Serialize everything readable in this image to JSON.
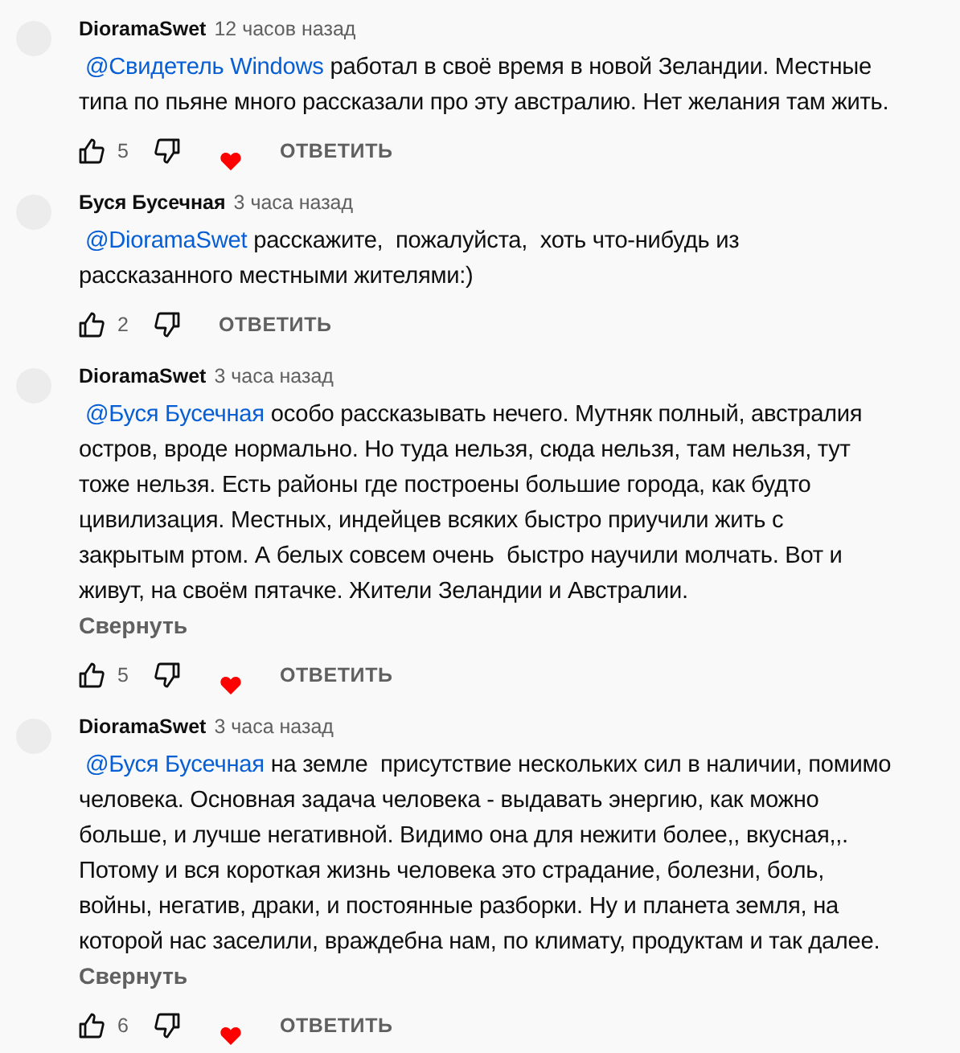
{
  "comments": [
    {
      "author": "DioramaSwet",
      "time": "12 часов назад",
      "mention": "@Свидетель Windows",
      "text": "работал в своё время в новой Зеландии. Местные\nтипа по пьяне много рассказали про эту австралию. Нет желания там жить.",
      "likes": "5",
      "hearted": true,
      "reply": "ОТВЕТИТЬ"
    },
    {
      "author": "Буся Бусечная",
      "time": "3 часа назад",
      "mention": "@DioramaSwet",
      "text": "расскажите,  пожалуйста,  хоть что-нибудь из\nрассказанного местными жителями:)",
      "likes": "2",
      "hearted": false,
      "reply": "ОТВЕТИТЬ"
    },
    {
      "author": "DioramaSwet",
      "time": "3 часа назад",
      "mention": "@Буся Бусечная",
      "text": "особо рассказывать нечего. Мутняк полный, австралия\nостров, вроде нормально. Но туда нельзя, сюда нельзя, там нельзя, тут\nтоже нельзя. Есть районы где построены большие города, как будто\nцивилизация. Местных, индейцев всяких быстро приучили жить с\nзакрытым ртом. А белых совсем очень  быстро научили молчать. Вот и\nживут, на своём пятачке. Жители Зеландии и Австралии.",
      "collapse": "Свернуть",
      "likes": "5",
      "hearted": true,
      "reply": "ОТВЕТИТЬ"
    },
    {
      "author": "DioramaSwet",
      "time": "3 часа назад",
      "mention": "@Буся Бусечная",
      "text": "на земле  присутствие нескольких сил в наличии, помимо\nчеловека. Основная задача человека - выдавать энергию, как можно\nбольше, и лучше негативной. Видимо она для нежити более,, вкусная,,.\nПотому и вся короткая жизнь человека это страдание, болезни, боль,\nвойны, негатив, драки, и постоянные разборки. Ну и планета земля, на\nкоторой нас заселили, враждебна нам, по климату, продуктам и так далее.",
      "collapse": "Свернуть",
      "likes": "6",
      "hearted": true,
      "reply": "ОТВЕТИТЬ"
    }
  ]
}
